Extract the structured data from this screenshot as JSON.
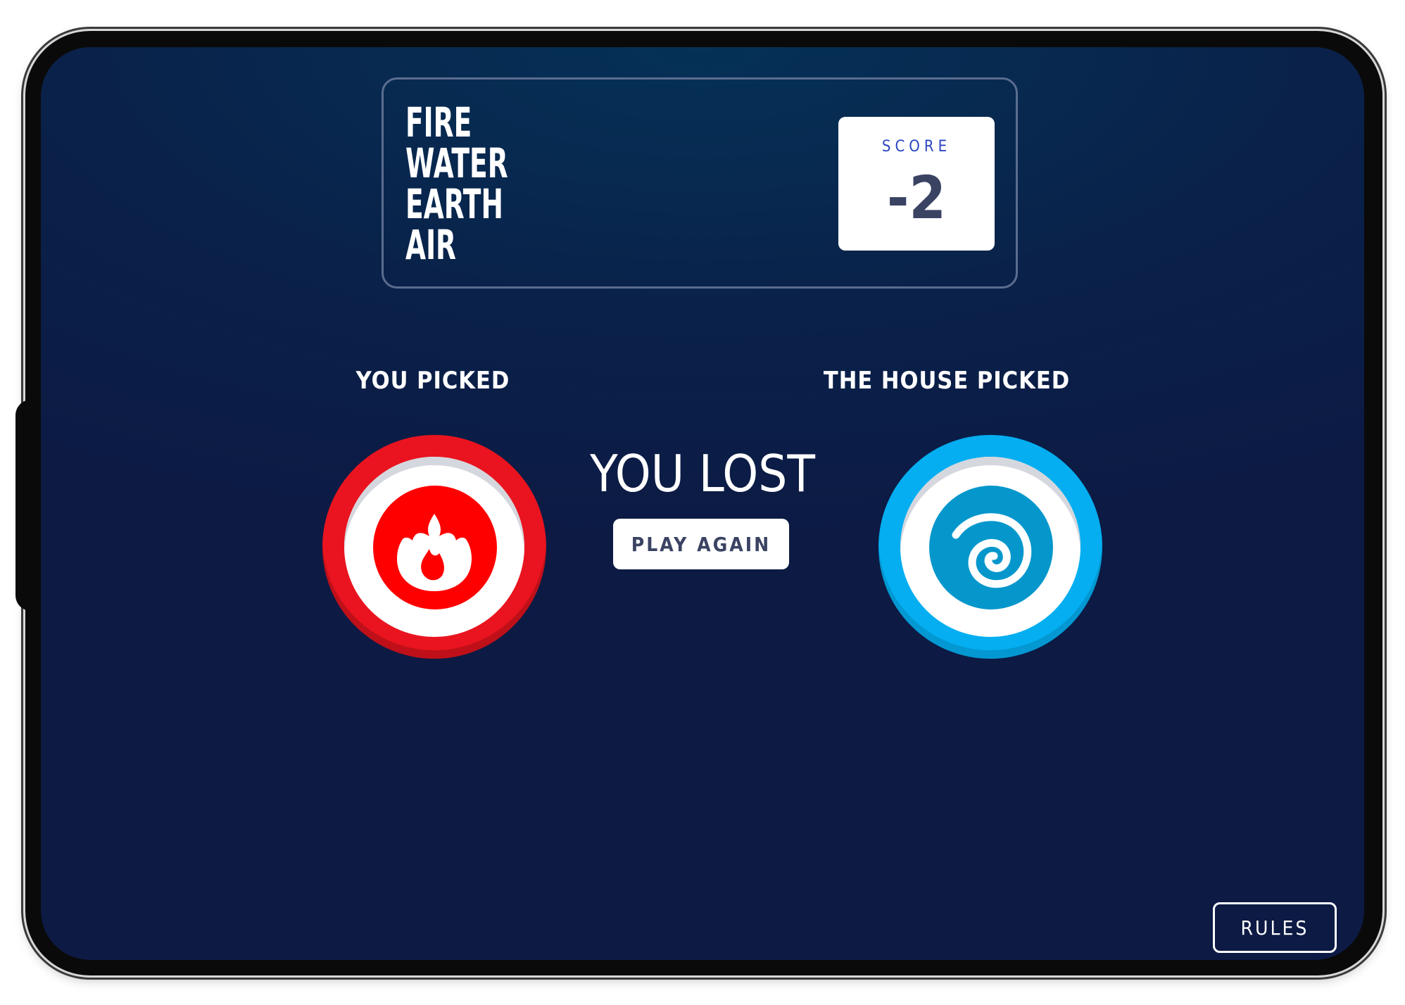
{
  "header": {
    "logo_lines": [
      "FIRE",
      "WATER",
      "EARTH",
      "AIR"
    ],
    "score_label": "SCORE",
    "score_value": "-2"
  },
  "player": {
    "label": "YOU PICKED",
    "choice_icon": "flame-icon",
    "ring_color": "#e9141f",
    "core_color": "#ff0000"
  },
  "house": {
    "label": "THE HOUSE PICKED",
    "choice_icon": "spiral-icon",
    "ring_color": "#04aef0",
    "core_color": "#0597cc"
  },
  "result": {
    "text": "YOU LOST",
    "play_again_label": "PLAY AGAIN"
  },
  "footer": {
    "rules_label": "RULES"
  },
  "colors": {
    "background_top": "#053157",
    "background_bottom": "#0c1a44",
    "score_label": "#2a46c0",
    "dark_text": "#3b4363"
  }
}
